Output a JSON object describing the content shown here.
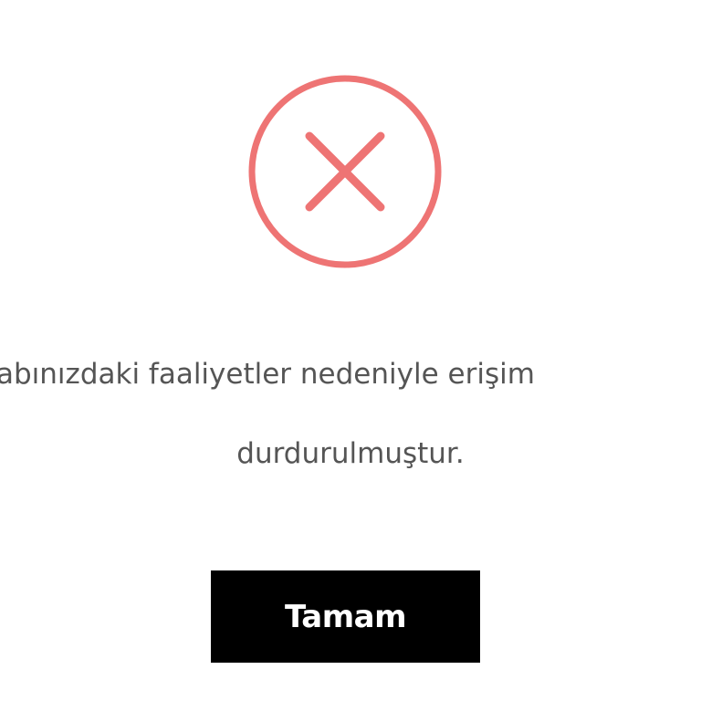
{
  "dialog": {
    "icon": "error-x-circle-icon",
    "accent_color": "#ee7474",
    "message_line1": "abınızdaki faaliyetler nedeniyle erişim",
    "message_line2": "durdurulmuştur.",
    "ok_button_label": "Tamam"
  }
}
